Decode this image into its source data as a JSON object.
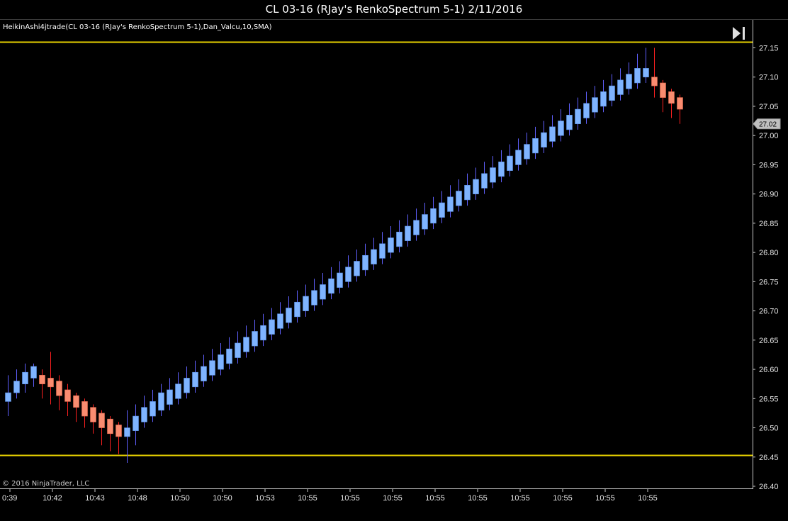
{
  "window": {
    "title": "CL 03-16 (RJay's RenkoSpectrum 5-1)  2/11/2016"
  },
  "indicator_label": "HeikinAshi4jtrade(CL 03-16 (RJay's RenkoSpectrum 5-1),Dan_Valcu,10,SMA)",
  "copyright": "© 2016 NinjaTrader, LLC",
  "last_price": "27.02",
  "colors": {
    "up": "#7fb4ff",
    "down": "#fa8c70",
    "wick_up": "#6060ff",
    "wick_down": "#ff2020",
    "hline": "#e6d000",
    "axis": "#c8c8c8",
    "background": "#000000"
  },
  "icons": {
    "scroll_end": "scroll-to-end-icon"
  },
  "chart_data": {
    "type": "candlestick",
    "ylim": [
      26.4,
      27.17
    ],
    "y_ticks": [
      27.15,
      27.1,
      27.05,
      27.0,
      26.95,
      26.9,
      26.85,
      26.8,
      26.75,
      26.7,
      26.65,
      26.6,
      26.55,
      26.5,
      26.45,
      26.4
    ],
    "x_tick_labels": [
      "0:39",
      "10:42",
      "10:43",
      "10:48",
      "10:50",
      "10:50",
      "10:53",
      "10:55",
      "10:55",
      "10:55",
      "10:55",
      "10:55",
      "10:55",
      "10:55",
      "10:55",
      "10:55"
    ],
    "horizontal_lines": [
      27.16,
      26.453
    ],
    "candles": [
      {
        "o": 26.545,
        "h": 26.59,
        "l": 26.52,
        "c": 26.56,
        "d": "up"
      },
      {
        "o": 26.56,
        "h": 26.6,
        "l": 26.55,
        "c": 26.58,
        "d": "up"
      },
      {
        "o": 26.575,
        "h": 26.61,
        "l": 26.56,
        "c": 26.595,
        "d": "up"
      },
      {
        "o": 26.585,
        "h": 26.61,
        "l": 26.57,
        "c": 26.605,
        "d": "up"
      },
      {
        "o": 26.59,
        "h": 26.6,
        "l": 26.55,
        "c": 26.575,
        "d": "down"
      },
      {
        "o": 26.585,
        "h": 26.63,
        "l": 26.54,
        "c": 26.57,
        "d": "down"
      },
      {
        "o": 26.58,
        "h": 26.59,
        "l": 26.53,
        "c": 26.555,
        "d": "down"
      },
      {
        "o": 26.565,
        "h": 26.575,
        "l": 26.52,
        "c": 26.545,
        "d": "down"
      },
      {
        "o": 26.555,
        "h": 26.56,
        "l": 26.51,
        "c": 26.535,
        "d": "down"
      },
      {
        "o": 26.545,
        "h": 26.55,
        "l": 26.5,
        "c": 26.52,
        "d": "down"
      },
      {
        "o": 26.535,
        "h": 26.54,
        "l": 26.49,
        "c": 26.51,
        "d": "down"
      },
      {
        "o": 26.525,
        "h": 26.53,
        "l": 26.47,
        "c": 26.5,
        "d": "down"
      },
      {
        "o": 26.515,
        "h": 26.52,
        "l": 26.46,
        "c": 26.49,
        "d": "down"
      },
      {
        "o": 26.505,
        "h": 26.51,
        "l": 26.455,
        "c": 26.485,
        "d": "down"
      },
      {
        "o": 26.485,
        "h": 26.53,
        "l": 26.44,
        "c": 26.5,
        "d": "up"
      },
      {
        "o": 26.495,
        "h": 26.54,
        "l": 26.47,
        "c": 26.52,
        "d": "up"
      },
      {
        "o": 26.51,
        "h": 26.555,
        "l": 26.5,
        "c": 26.535,
        "d": "up"
      },
      {
        "o": 26.52,
        "h": 26.565,
        "l": 26.51,
        "c": 26.545,
        "d": "up"
      },
      {
        "o": 26.53,
        "h": 26.575,
        "l": 26.52,
        "c": 26.56,
        "d": "up"
      },
      {
        "o": 26.54,
        "h": 26.585,
        "l": 26.53,
        "c": 26.565,
        "d": "up"
      },
      {
        "o": 26.55,
        "h": 26.595,
        "l": 26.54,
        "c": 26.575,
        "d": "up"
      },
      {
        "o": 26.56,
        "h": 26.605,
        "l": 26.55,
        "c": 26.585,
        "d": "up"
      },
      {
        "o": 26.57,
        "h": 26.615,
        "l": 26.56,
        "c": 26.595,
        "d": "up"
      },
      {
        "o": 26.58,
        "h": 26.625,
        "l": 26.57,
        "c": 26.605,
        "d": "up"
      },
      {
        "o": 26.59,
        "h": 26.635,
        "l": 26.58,
        "c": 26.615,
        "d": "up"
      },
      {
        "o": 26.6,
        "h": 26.645,
        "l": 26.59,
        "c": 26.625,
        "d": "up"
      },
      {
        "o": 26.61,
        "h": 26.655,
        "l": 26.6,
        "c": 26.635,
        "d": "up"
      },
      {
        "o": 26.62,
        "h": 26.665,
        "l": 26.61,
        "c": 26.645,
        "d": "up"
      },
      {
        "o": 26.63,
        "h": 26.675,
        "l": 26.62,
        "c": 26.655,
        "d": "up"
      },
      {
        "o": 26.64,
        "h": 26.685,
        "l": 26.63,
        "c": 26.665,
        "d": "up"
      },
      {
        "o": 26.65,
        "h": 26.695,
        "l": 26.64,
        "c": 26.675,
        "d": "up"
      },
      {
        "o": 26.66,
        "h": 26.705,
        "l": 26.65,
        "c": 26.685,
        "d": "up"
      },
      {
        "o": 26.67,
        "h": 26.715,
        "l": 26.66,
        "c": 26.695,
        "d": "up"
      },
      {
        "o": 26.68,
        "h": 26.725,
        "l": 26.67,
        "c": 26.705,
        "d": "up"
      },
      {
        "o": 26.69,
        "h": 26.735,
        "l": 26.68,
        "c": 26.715,
        "d": "up"
      },
      {
        "o": 26.7,
        "h": 26.745,
        "l": 26.69,
        "c": 26.725,
        "d": "up"
      },
      {
        "o": 26.71,
        "h": 26.755,
        "l": 26.7,
        "c": 26.735,
        "d": "up"
      },
      {
        "o": 26.72,
        "h": 26.765,
        "l": 26.71,
        "c": 26.745,
        "d": "up"
      },
      {
        "o": 26.73,
        "h": 26.775,
        "l": 26.72,
        "c": 26.755,
        "d": "up"
      },
      {
        "o": 26.74,
        "h": 26.785,
        "l": 26.73,
        "c": 26.765,
        "d": "up"
      },
      {
        "o": 26.75,
        "h": 26.795,
        "l": 26.74,
        "c": 26.775,
        "d": "up"
      },
      {
        "o": 26.76,
        "h": 26.805,
        "l": 26.75,
        "c": 26.785,
        "d": "up"
      },
      {
        "o": 26.77,
        "h": 26.815,
        "l": 26.76,
        "c": 26.795,
        "d": "up"
      },
      {
        "o": 26.78,
        "h": 26.825,
        "l": 26.77,
        "c": 26.805,
        "d": "up"
      },
      {
        "o": 26.79,
        "h": 26.835,
        "l": 26.78,
        "c": 26.815,
        "d": "up"
      },
      {
        "o": 26.8,
        "h": 26.845,
        "l": 26.79,
        "c": 26.825,
        "d": "up"
      },
      {
        "o": 26.81,
        "h": 26.855,
        "l": 26.8,
        "c": 26.835,
        "d": "up"
      },
      {
        "o": 26.82,
        "h": 26.865,
        "l": 26.81,
        "c": 26.845,
        "d": "up"
      },
      {
        "o": 26.83,
        "h": 26.875,
        "l": 26.82,
        "c": 26.855,
        "d": "up"
      },
      {
        "o": 26.84,
        "h": 26.885,
        "l": 26.83,
        "c": 26.865,
        "d": "up"
      },
      {
        "o": 26.85,
        "h": 26.895,
        "l": 26.84,
        "c": 26.875,
        "d": "up"
      },
      {
        "o": 26.86,
        "h": 26.905,
        "l": 26.85,
        "c": 26.885,
        "d": "up"
      },
      {
        "o": 26.87,
        "h": 26.915,
        "l": 26.86,
        "c": 26.895,
        "d": "up"
      },
      {
        "o": 26.88,
        "h": 26.925,
        "l": 26.87,
        "c": 26.905,
        "d": "up"
      },
      {
        "o": 26.89,
        "h": 26.935,
        "l": 26.88,
        "c": 26.915,
        "d": "up"
      },
      {
        "o": 26.9,
        "h": 26.945,
        "l": 26.89,
        "c": 26.925,
        "d": "up"
      },
      {
        "o": 26.91,
        "h": 26.955,
        "l": 26.9,
        "c": 26.935,
        "d": "up"
      },
      {
        "o": 26.92,
        "h": 26.965,
        "l": 26.91,
        "c": 26.945,
        "d": "up"
      },
      {
        "o": 26.93,
        "h": 26.975,
        "l": 26.92,
        "c": 26.955,
        "d": "up"
      },
      {
        "o": 26.94,
        "h": 26.985,
        "l": 26.93,
        "c": 26.965,
        "d": "up"
      },
      {
        "o": 26.95,
        "h": 26.995,
        "l": 26.94,
        "c": 26.975,
        "d": "up"
      },
      {
        "o": 26.96,
        "h": 27.005,
        "l": 26.95,
        "c": 26.985,
        "d": "up"
      },
      {
        "o": 26.97,
        "h": 27.015,
        "l": 26.96,
        "c": 26.995,
        "d": "up"
      },
      {
        "o": 26.98,
        "h": 27.025,
        "l": 26.97,
        "c": 27.005,
        "d": "up"
      },
      {
        "o": 26.99,
        "h": 27.035,
        "l": 26.98,
        "c": 27.015,
        "d": "up"
      },
      {
        "o": 27.0,
        "h": 27.045,
        "l": 26.99,
        "c": 27.025,
        "d": "up"
      },
      {
        "o": 27.01,
        "h": 27.055,
        "l": 27.0,
        "c": 27.035,
        "d": "up"
      },
      {
        "o": 27.02,
        "h": 27.065,
        "l": 27.01,
        "c": 27.045,
        "d": "up"
      },
      {
        "o": 27.03,
        "h": 27.075,
        "l": 27.02,
        "c": 27.055,
        "d": "up"
      },
      {
        "o": 27.04,
        "h": 27.085,
        "l": 27.03,
        "c": 27.065,
        "d": "up"
      },
      {
        "o": 27.05,
        "h": 27.095,
        "l": 27.04,
        "c": 27.075,
        "d": "up"
      },
      {
        "o": 27.06,
        "h": 27.105,
        "l": 27.05,
        "c": 27.085,
        "d": "up"
      },
      {
        "o": 27.07,
        "h": 27.115,
        "l": 27.06,
        "c": 27.095,
        "d": "up"
      },
      {
        "o": 27.08,
        "h": 27.125,
        "l": 27.07,
        "c": 27.105,
        "d": "up"
      },
      {
        "o": 27.09,
        "h": 27.14,
        "l": 27.08,
        "c": 27.115,
        "d": "up"
      },
      {
        "o": 27.1,
        "h": 27.15,
        "l": 27.09,
        "c": 27.115,
        "d": "up"
      },
      {
        "o": 27.1,
        "h": 27.15,
        "l": 27.065,
        "c": 27.085,
        "d": "down"
      },
      {
        "o": 27.09,
        "h": 27.095,
        "l": 27.04,
        "c": 27.065,
        "d": "down"
      },
      {
        "o": 27.075,
        "h": 27.08,
        "l": 27.03,
        "c": 27.055,
        "d": "down"
      },
      {
        "o": 27.065,
        "h": 27.07,
        "l": 27.02,
        "c": 27.045,
        "d": "down"
      }
    ]
  }
}
